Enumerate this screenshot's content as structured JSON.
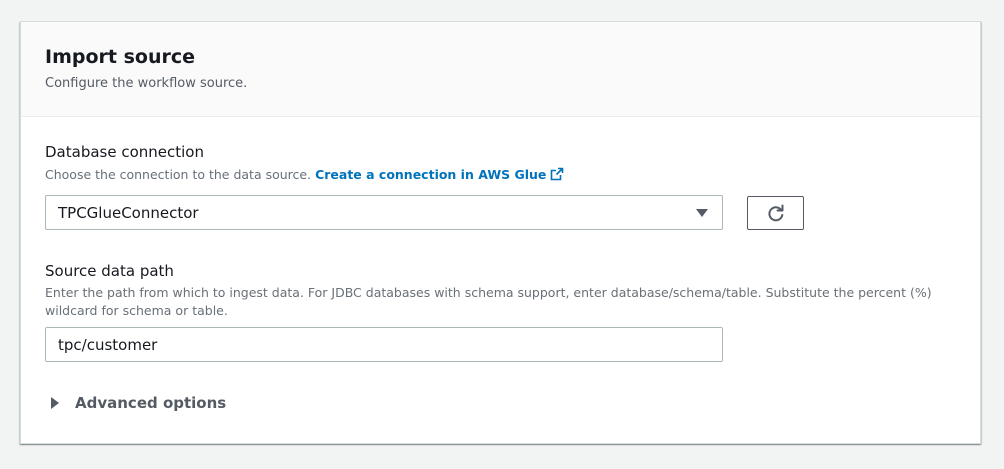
{
  "panel": {
    "title": "Import source",
    "description": "Configure the workflow source."
  },
  "database_connection": {
    "label": "Database connection",
    "hint": "Choose the connection to the data source.",
    "link_text": "Create a connection in AWS Glue",
    "selected_value": "TPCGlueConnector",
    "link_icon": "external-link-icon",
    "refresh_icon": "refresh-icon"
  },
  "source_data_path": {
    "label": "Source data path",
    "hint": "Enter the path from which to ingest data. For JDBC databases with schema support, enter database/schema/table. Substitute the percent (%) wildcard for schema or table.",
    "value": "tpc/customer"
  },
  "advanced_options": {
    "label": "Advanced options",
    "icon": "caret-right-icon"
  },
  "colors": {
    "link": "#0073bb",
    "text": "#16191f",
    "muted": "#687078",
    "border": "#aab7b8"
  }
}
